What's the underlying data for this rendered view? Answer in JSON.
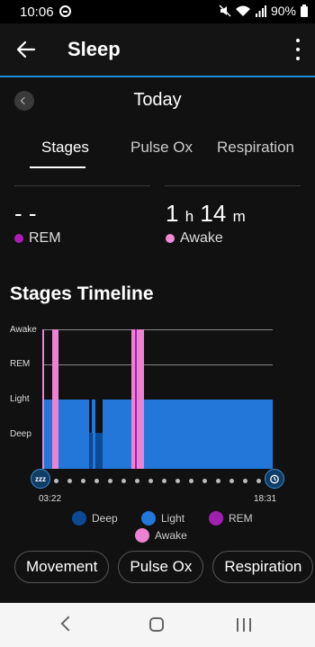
{
  "status_bar": {
    "time": "10:06",
    "battery": "90%"
  },
  "app_bar": {
    "title": "Sleep"
  },
  "date_nav": {
    "title": "Today"
  },
  "tabs": [
    {
      "label": "Stages",
      "active": true
    },
    {
      "label": "Pulse Ox",
      "active": false
    },
    {
      "label": "Respiration",
      "active": false
    }
  ],
  "stats": {
    "rem": {
      "value": "- -",
      "label": "REM",
      "color": "#b01ab8"
    },
    "awake": {
      "hours": "1",
      "h_unit": "h",
      "minutes": "14",
      "m_unit": "m",
      "label": "Awake",
      "color": "#f08ad4"
    }
  },
  "timeline": {
    "title": "Stages Timeline",
    "y_labels": [
      "Awake",
      "REM",
      "Light",
      "Deep"
    ],
    "start_time": "03:22",
    "end_time": "18:31",
    "start_badge": "zzz",
    "colors": {
      "deep": "#0d4a94",
      "light": "#2377d9",
      "rem": "#a020b0",
      "awake": "#ec82d2"
    }
  },
  "legend": {
    "deep": "Deep",
    "light": "Light",
    "rem": "REM",
    "awake": "Awake"
  },
  "chips": [
    "Movement",
    "Pulse Ox",
    "Respiration"
  ]
}
